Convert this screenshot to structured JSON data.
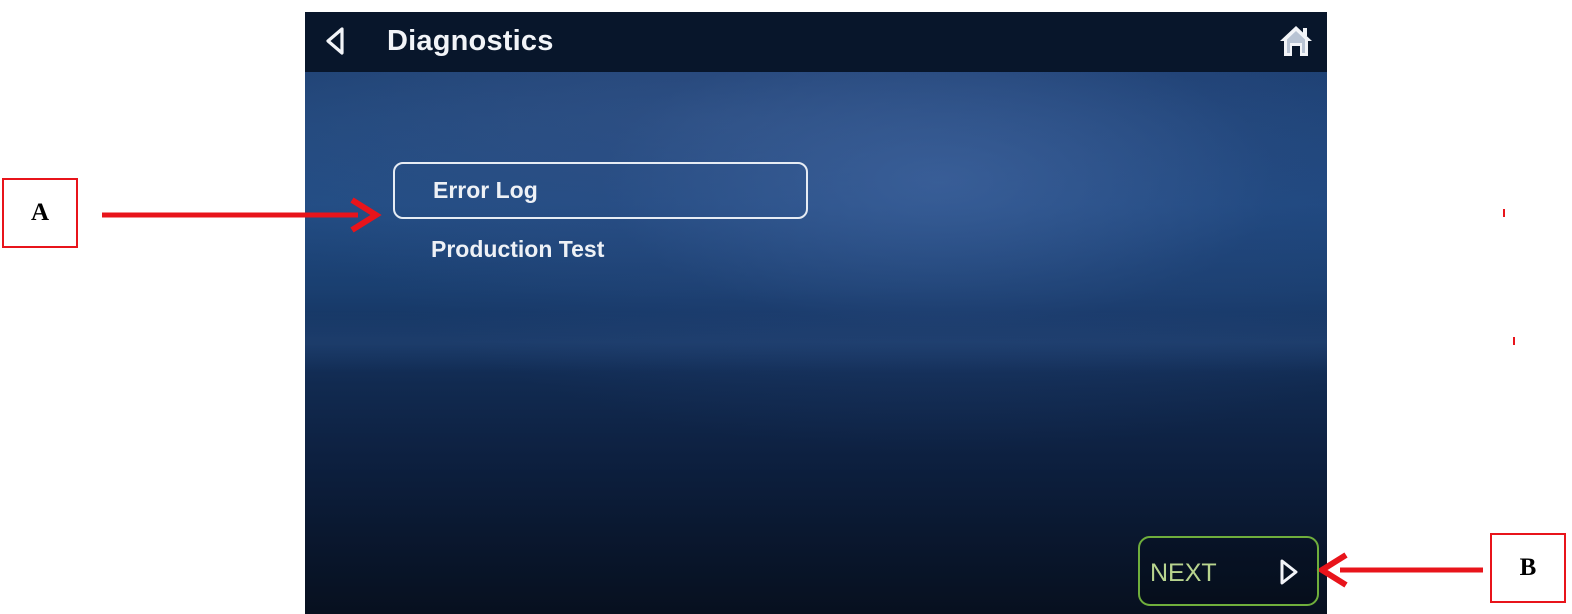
{
  "header": {
    "title": "Diagnostics",
    "back_icon": "chevron-left-icon",
    "home_icon": "home-icon"
  },
  "menu": {
    "items": [
      {
        "label": "Error Log",
        "selected": true
      },
      {
        "label": "Production Test",
        "selected": false
      }
    ]
  },
  "footer": {
    "next_label": "NEXT",
    "next_icon": "chevron-right-icon"
  },
  "annotations": {
    "a_label": "A",
    "b_label": "B"
  },
  "colors": {
    "titlebar": "#08162b",
    "next_border": "#6fae3c",
    "next_text": "#b8d48e",
    "annotation": "#e8141b"
  }
}
